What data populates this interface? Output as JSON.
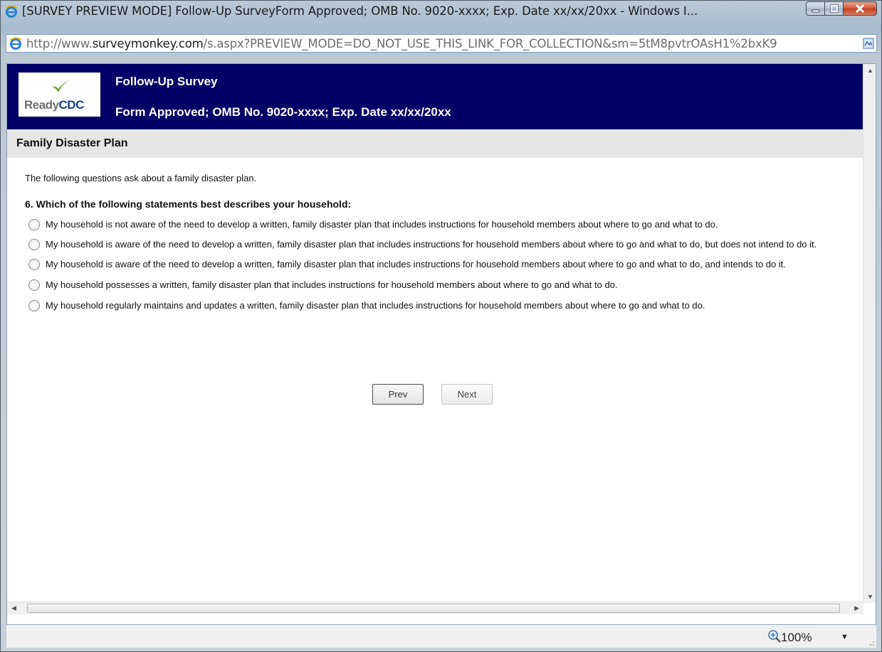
{
  "window": {
    "title": "[SURVEY PREVIEW MODE] Follow-Up SurveyForm Approved; OMB No. 9020-xxxx; Exp. Date xx/xx/20xx - Windows I...",
    "controls": [
      "minimize",
      "maximize",
      "close"
    ]
  },
  "address": {
    "prefix": "http://www.",
    "domain": "surveymonkey.com",
    "path": "/s.aspx?PREVIEW_MODE=DO_NOT_USE_THIS_LINK_FOR_COLLECTION&sm=5tM8pvtrOAsH1%2bxK9"
  },
  "header": {
    "logo_text_1": "Ready",
    "logo_text_2": "CDC",
    "title": "Follow-Up Survey",
    "subtitle": "Form Approved; OMB No. 9020-xxxx; Exp. Date xx/xx/20xx"
  },
  "section": {
    "title": "Family Disaster Plan",
    "intro": "The following questions ask about a family disaster plan."
  },
  "question": {
    "text": "6. Which of the following statements best describes your household:",
    "options": [
      "My household is not aware of the need to develop a written, family disaster plan that includes instructions for household members about where to go and what to do.",
      "My household is aware of the need to develop a written, family disaster plan that includes instructions for household members about where to go and what to do, but does not intend to do it.",
      "My household is aware of the need to develop a written, family disaster plan that includes instructions for household members about where to go and what to do, and intends to do it.",
      "My household possesses a written, family disaster plan that includes instructions for household members about where to go and what to do.",
      "My household regularly maintains and updates a written, family disaster plan that includes instructions for household members about where to go and what to do."
    ]
  },
  "nav": {
    "prev": "Prev",
    "next": "Next"
  },
  "status": {
    "zoom": "100%"
  },
  "colors": {
    "header_bg": "#000066",
    "section_bg": "#e6e6e6"
  }
}
